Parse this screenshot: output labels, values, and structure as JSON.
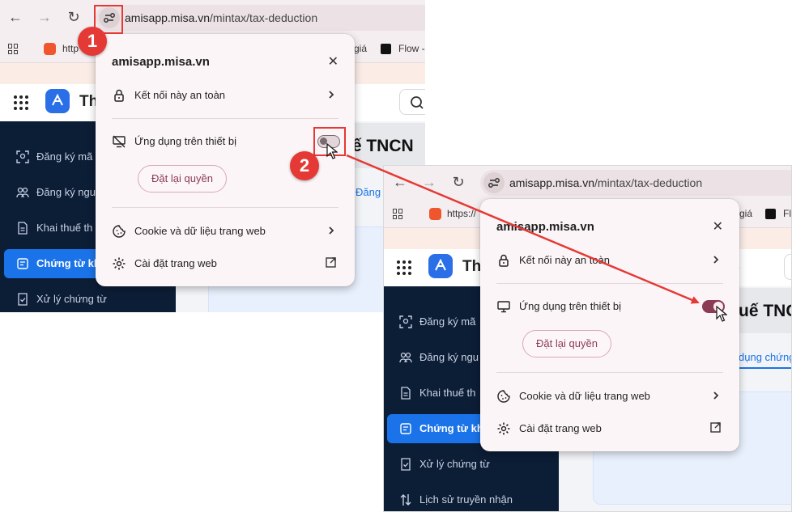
{
  "browser": {
    "url_host": "amisapp.misa.vn",
    "url_path": "/mintax/tax-deduction",
    "bookmarks": [
      "http",
      "giá",
      "Flow -"
    ],
    "bookmarks_2": [
      "https://",
      "giá",
      "Flo"
    ]
  },
  "app": {
    "name_partial": "Th",
    "page_title_partial": "uế TNCN",
    "tab_partial_1": "Đăng c",
    "tab_partial_2": "dụng chứng"
  },
  "sidebar": {
    "items": [
      {
        "label": "Đăng ký mã",
        "icon": "face-scan-icon"
      },
      {
        "label": "Đăng ký ngu",
        "icon": "people-icon"
      },
      {
        "label": "Khai thuế th",
        "icon": "document-icon"
      },
      {
        "label": "Chứng từ kh",
        "icon": "receipt-icon",
        "active": true
      },
      {
        "label": "Xử lý chứng từ",
        "icon": "check-doc-icon"
      },
      {
        "label": "Lịch sử truyền nhận",
        "icon": "transfer-icon"
      }
    ]
  },
  "popup": {
    "title": "amisapp.misa.vn",
    "secure_label": "Kết nối này an toàn",
    "device_apps_label": "Ứng dụng trên thiết bị",
    "reset_button": "Đặt lại quyền",
    "cookies_label": "Cookie và dữ liệu trang web",
    "site_settings_label": "Cài đặt trang web"
  },
  "steps": {
    "step1": "1",
    "step2": "2"
  },
  "toggle_state": {
    "before": "off",
    "after": "on"
  },
  "colors": {
    "annotation_red": "#e53935",
    "toggle_on": "#8c3b54",
    "sidebar_bg": "#0c1d36",
    "active_nav": "#1a73e8"
  }
}
